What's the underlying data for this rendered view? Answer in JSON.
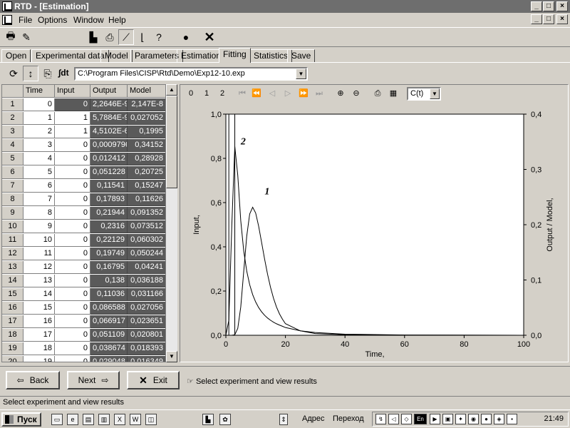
{
  "title": "RTD - [Estimation]",
  "menu": [
    "File",
    "Options",
    "Window",
    "Help"
  ],
  "tabs": [
    "Open",
    "Experimental data",
    "Model",
    "Parameters",
    "Estimation",
    "Fitting",
    "Statistics",
    "Save"
  ],
  "active_tab": "Fitting",
  "file_label": "∫dt",
  "file_path": "C:\\Program Files\\CISP\\Rtd\\Demo\\Exp12-10.exp",
  "grid": {
    "headers": [
      "Time",
      "Input",
      "Output",
      "Model"
    ],
    "rows": [
      [
        "1",
        "0",
        "0",
        "2,2646E-9",
        "2,147E-8"
      ],
      [
        "2",
        "1",
        "1",
        "5,7884E-9",
        "0,027052"
      ],
      [
        "3",
        "2",
        "1",
        "4,5102E-6",
        "0,1995"
      ],
      [
        "4",
        "3",
        "0",
        "0,00097967",
        "0,34152"
      ],
      [
        "5",
        "4",
        "0",
        "0,012412",
        "0,28928"
      ],
      [
        "6",
        "5",
        "0",
        "0,051228",
        "0,20725"
      ],
      [
        "7",
        "6",
        "0",
        "0,11541",
        "0,15247"
      ],
      [
        "8",
        "7",
        "0",
        "0,17893",
        "0,11626"
      ],
      [
        "9",
        "8",
        "0",
        "0,21944",
        "0,091352"
      ],
      [
        "10",
        "9",
        "0",
        "0,2316",
        "0,073512"
      ],
      [
        "11",
        "10",
        "0",
        "0,22129",
        "0,060302"
      ],
      [
        "12",
        "11",
        "0",
        "0,19749",
        "0,050244"
      ],
      [
        "13",
        "12",
        "0",
        "0,16795",
        "0,04241"
      ],
      [
        "14",
        "13",
        "0",
        "0,138",
        "0,036188"
      ],
      [
        "15",
        "14",
        "0",
        "0,11036",
        "0,031166"
      ],
      [
        "16",
        "15",
        "0",
        "0,086588",
        "0,027056"
      ],
      [
        "17",
        "16",
        "0",
        "0,066917",
        "0,023651"
      ],
      [
        "18",
        "17",
        "0",
        "0,051109",
        "0,020801"
      ],
      [
        "19",
        "18",
        "0",
        "0,038674",
        "0,018393"
      ],
      [
        "20",
        "19",
        "0",
        "0,029048",
        "0,016349"
      ]
    ]
  },
  "chart_tools": {
    "tabs": [
      "0",
      "1",
      "2"
    ],
    "series_select": "C(t)"
  },
  "chart_data": {
    "type": "line",
    "xlabel": "Time,",
    "ylabel_left": "Input,",
    "ylabel_right": "Output / Model,",
    "xlim": [
      0,
      100
    ],
    "ylim_left": [
      0,
      1
    ],
    "ylim_right": [
      0,
      0.4
    ],
    "x_ticks": [
      "0",
      "20",
      "40",
      "60",
      "80",
      "100"
    ],
    "y_left_ticks": [
      "0,0",
      "0,2",
      "0,4",
      "0,6",
      "0,8",
      "1,0"
    ],
    "y_right_ticks": [
      "0,0",
      "0,1",
      "0,2",
      "0,3",
      "0,4"
    ],
    "annotations": [
      "1",
      "2"
    ],
    "series": [
      {
        "name": "Input",
        "axis": "left",
        "x": [
          0,
          1,
          2,
          3,
          4,
          5,
          100
        ],
        "y": [
          0,
          1,
          1,
          0,
          0,
          0,
          0
        ]
      },
      {
        "name": "1",
        "axis": "right",
        "x": [
          0,
          2,
          3,
          4,
          5,
          6,
          7,
          8,
          9,
          10,
          11,
          12,
          13,
          14,
          15,
          16,
          17,
          18,
          19,
          20,
          25,
          30,
          40,
          60,
          100
        ],
        "y": [
          0,
          5e-06,
          0.001,
          0.0124,
          0.0512,
          0.1154,
          0.1789,
          0.2194,
          0.2316,
          0.2213,
          0.1975,
          0.168,
          0.138,
          0.1104,
          0.0866,
          0.0669,
          0.0511,
          0.0387,
          0.029,
          0.021,
          0.008,
          0.003,
          0.001,
          0.0002,
          0
        ]
      },
      {
        "name": "2",
        "axis": "right",
        "x": [
          0,
          1,
          2,
          3,
          4,
          5,
          6,
          7,
          8,
          9,
          10,
          11,
          12,
          13,
          14,
          15,
          16,
          17,
          18,
          19,
          20,
          25,
          30,
          40,
          60,
          100
        ],
        "y": [
          0,
          0.0271,
          0.1995,
          0.3415,
          0.2893,
          0.2073,
          0.1525,
          0.1163,
          0.0914,
          0.0735,
          0.0603,
          0.0502,
          0.0424,
          0.0362,
          0.0312,
          0.0271,
          0.0237,
          0.0208,
          0.0184,
          0.0163,
          0.014,
          0.008,
          0.005,
          0.002,
          0.0005,
          0
        ]
      }
    ]
  },
  "nav": {
    "back": "Back",
    "next": "Next",
    "exit": "Exit",
    "hint": "Select experiment and view results"
  },
  "status": "Select experiment and view results",
  "taskbar": {
    "start": "Пуск",
    "address": "Адрес",
    "go": "Переход",
    "clock": "21:49",
    "lang": "En"
  }
}
